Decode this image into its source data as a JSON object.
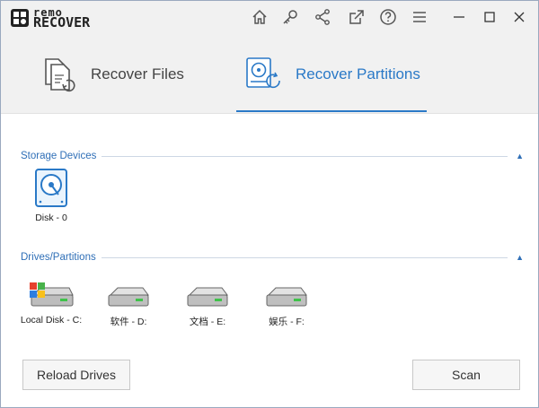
{
  "app": {
    "logo_top": "remo",
    "logo_bottom": "RECOVER"
  },
  "titlebar": {
    "icons": [
      "home-icon",
      "key-icon",
      "share-icon",
      "external-link-icon",
      "help-icon",
      "menu-icon",
      "minimize-icon",
      "maximize-icon",
      "close-icon"
    ]
  },
  "tabs": [
    {
      "label": "Recover Files",
      "icon": "recover-files-icon",
      "active": false
    },
    {
      "label": "Recover Partitions",
      "icon": "recover-partitions-icon",
      "active": true
    }
  ],
  "storage": {
    "title": "Storage Devices",
    "devices": [
      {
        "label": "Disk - 0"
      }
    ]
  },
  "drives": {
    "title": "Drives/Partitions",
    "items": [
      {
        "label": "Local Disk - C:",
        "icon": "windows-drive-icon"
      },
      {
        "label": "软件 - D:",
        "icon": "drive-icon"
      },
      {
        "label": "文档 - E:",
        "icon": "drive-icon"
      },
      {
        "label": "娱乐 - F:",
        "icon": "drive-icon"
      }
    ]
  },
  "buttons": {
    "reload": "Reload Drives",
    "scan": "Scan"
  },
  "colors": {
    "accent": "#2a79c7",
    "header_bg": "#f1f1f1"
  }
}
